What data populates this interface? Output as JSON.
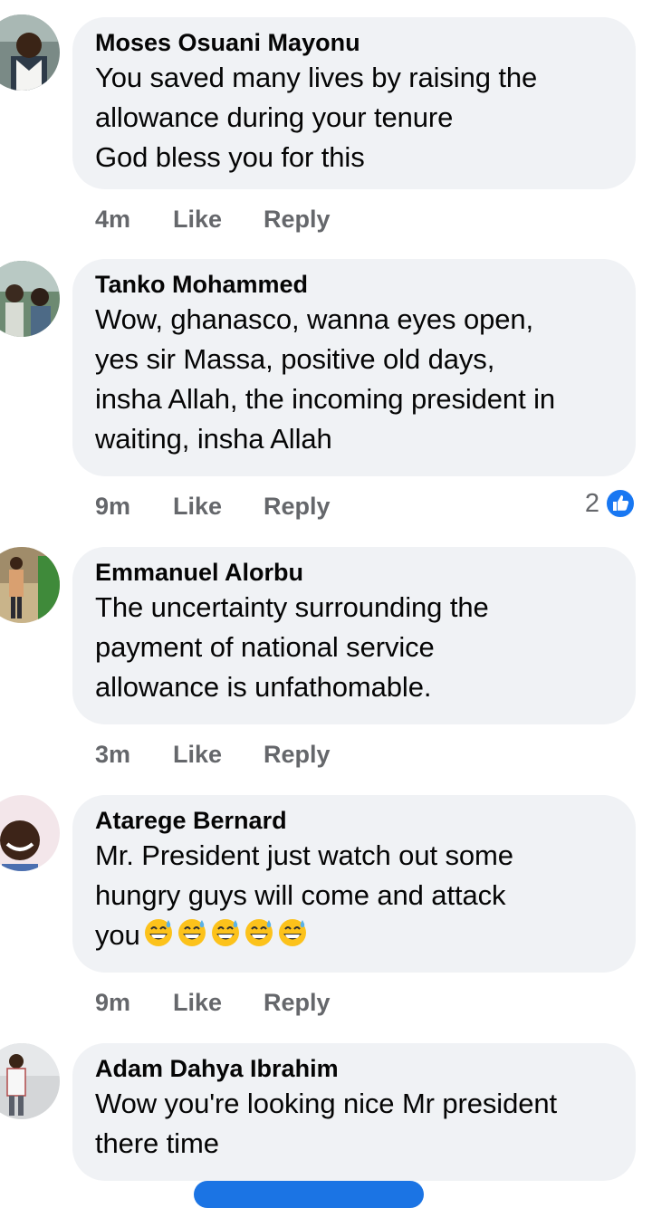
{
  "comments": [
    {
      "author": "Moses Osuani Mayonu",
      "text": "You saved many lives by raising the allowance during your tenure God bless you for this",
      "lines": [
        "You saved many lives by raising the",
        "allowance during your tenure",
        "God bless you for this"
      ],
      "time": "4m",
      "like_label": "Like",
      "reply_label": "Reply"
    },
    {
      "author": "Tanko Mohammed",
      "lines": [
        "Wow, ghanasco, wanna eyes open,",
        "yes sir Massa, positive old days,",
        "insha Allah, the incoming president in",
        "waiting, insha Allah"
      ],
      "time": "9m",
      "like_label": "Like",
      "reply_label": "Reply",
      "reaction_count": "2",
      "reaction_icon": "thumbs-up-icon"
    },
    {
      "author": "Emmanuel Alorbu",
      "lines": [
        "The uncertainty surrounding the",
        "payment of national service",
        "allowance is unfathomable."
      ],
      "time": "3m",
      "like_label": "Like",
      "reply_label": "Reply"
    },
    {
      "author": "Atarege Bernard",
      "lines": [
        "Mr. President just watch out some",
        "hungry guys will come and attack",
        "you"
      ],
      "emoji": "grinning-sweat-emoji",
      "emoji_count": 5,
      "time": "9m",
      "like_label": "Like",
      "reply_label": "Reply"
    },
    {
      "author": "Adam Dahya Ibrahim",
      "lines": [
        "Wow you're looking nice Mr president",
        "there time"
      ]
    }
  ],
  "colors": {
    "bubble": "#f0f2f5",
    "meta_text": "#65676b",
    "like_blue": "#1877f2"
  }
}
